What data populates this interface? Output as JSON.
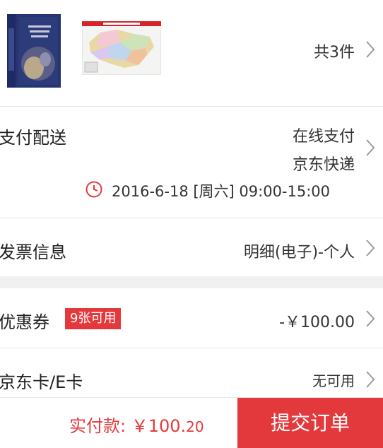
{
  "products": {
    "count_text": "共3件",
    "book_title_lines": [
      "清明上河",
      "艺术",
      "AQE"
    ]
  },
  "delivery": {
    "label": "支付配送",
    "payment": "在线支付",
    "courier": "京东快递",
    "time": "2016-6-18 [周六] 09:00-15:00"
  },
  "invoice": {
    "label": "发票信息",
    "value": "明细(电子)-个人"
  },
  "coupon": {
    "label": "优惠券",
    "badge": "9张可用",
    "value": "-￥100.00"
  },
  "jdcard": {
    "label": "京东卡/E卡",
    "value": "无可用"
  },
  "bottom": {
    "paid_label": "实付款: ￥100.",
    "paid_cents": "20",
    "submit_label": "提交订单"
  },
  "colors": {
    "accent": "#e4393c",
    "divider": "#e4e4e4",
    "gap": "#f0f0f0"
  },
  "icons": [
    "clock-icon",
    "chevron-right-icon"
  ]
}
